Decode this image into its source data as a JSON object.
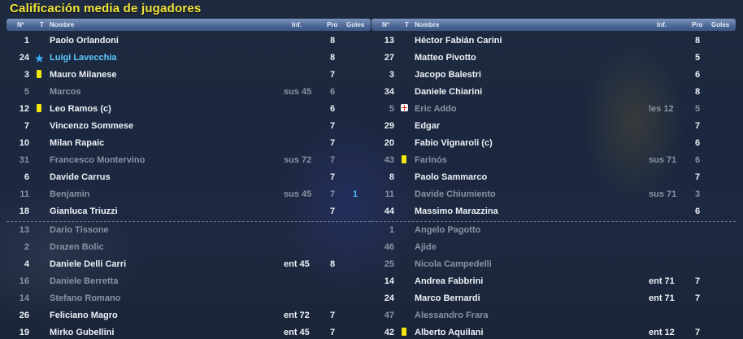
{
  "title": "Calificación media de jugadores",
  "headers": {
    "no": "Nº",
    "t": "T",
    "name": "Nombre",
    "inf": "Inf.",
    "pro": "Pro",
    "goles": "Goles"
  },
  "left": {
    "starters": [
      {
        "no": "1",
        "mark": "",
        "name": "Paolo Orlandoni",
        "inf": "",
        "pro": "8",
        "goles": "",
        "style": "normal"
      },
      {
        "no": "24",
        "mark": "star",
        "name": "Luigi Lavecchia",
        "inf": "",
        "pro": "8",
        "goles": "",
        "style": "highlight"
      },
      {
        "no": "3",
        "mark": "yellow",
        "name": "Mauro Milanese",
        "inf": "",
        "pro": "7",
        "goles": "",
        "style": "normal"
      },
      {
        "no": "5",
        "mark": "",
        "name": "Marcos",
        "inf": "sus 45",
        "pro": "6",
        "goles": "",
        "style": "dim"
      },
      {
        "no": "12",
        "mark": "yellow",
        "name": "Leo Ramos (c)",
        "inf": "",
        "pro": "6",
        "goles": "",
        "style": "normal"
      },
      {
        "no": "7",
        "mark": "",
        "name": "Vincenzo Sommese",
        "inf": "",
        "pro": "7",
        "goles": "",
        "style": "normal"
      },
      {
        "no": "10",
        "mark": "",
        "name": "Milan Rapaic",
        "inf": "",
        "pro": "7",
        "goles": "",
        "style": "normal"
      },
      {
        "no": "31",
        "mark": "",
        "name": "Francesco Montervino",
        "inf": "sus 72",
        "pro": "7",
        "goles": "",
        "style": "dim"
      },
      {
        "no": "6",
        "mark": "",
        "name": "Davide Carrus",
        "inf": "",
        "pro": "7",
        "goles": "",
        "style": "normal"
      },
      {
        "no": "11",
        "mark": "",
        "name": "Benjamin",
        "inf": "sus 45",
        "pro": "7",
        "goles": "1",
        "style": "dim"
      },
      {
        "no": "18",
        "mark": "",
        "name": "Gianluca Triuzzi",
        "inf": "",
        "pro": "7",
        "goles": "",
        "style": "normal"
      }
    ],
    "subs": [
      {
        "no": "13",
        "mark": "",
        "name": "Dario Tissone",
        "inf": "",
        "pro": "",
        "goles": "",
        "style": "dim"
      },
      {
        "no": "2",
        "mark": "",
        "name": "Drazen Bolic",
        "inf": "",
        "pro": "",
        "goles": "",
        "style": "dim"
      },
      {
        "no": "4",
        "mark": "",
        "name": "Daniele Delli Carri",
        "inf": "ent 45",
        "pro": "8",
        "goles": "",
        "style": "normal"
      },
      {
        "no": "16",
        "mark": "",
        "name": "Daniele Berretta",
        "inf": "",
        "pro": "",
        "goles": "",
        "style": "dim"
      },
      {
        "no": "14",
        "mark": "",
        "name": "Stefano Romano",
        "inf": "",
        "pro": "",
        "goles": "",
        "style": "dim"
      },
      {
        "no": "26",
        "mark": "",
        "name": "Feliciano Magro",
        "inf": "ent 72",
        "pro": "7",
        "goles": "",
        "style": "normal"
      },
      {
        "no": "19",
        "mark": "",
        "name": "Mirko Gubellini",
        "inf": "ent 45",
        "pro": "7",
        "goles": "",
        "style": "normal"
      }
    ]
  },
  "right": {
    "starters": [
      {
        "no": "13",
        "mark": "",
        "name": "Héctor Fabián Carini",
        "inf": "",
        "pro": "8",
        "goles": "",
        "style": "normal"
      },
      {
        "no": "27",
        "mark": "",
        "name": "Matteo Pivotto",
        "inf": "",
        "pro": "5",
        "goles": "",
        "style": "normal"
      },
      {
        "no": "3",
        "mark": "",
        "name": "Jacopo Balestri",
        "inf": "",
        "pro": "6",
        "goles": "",
        "style": "normal"
      },
      {
        "no": "34",
        "mark": "",
        "name": "Daniele Chiarini",
        "inf": "",
        "pro": "8",
        "goles": "",
        "style": "normal"
      },
      {
        "no": "5",
        "mark": "injury",
        "name": "Eric Addo",
        "inf": "les 12",
        "pro": "5",
        "goles": "",
        "style": "dim"
      },
      {
        "no": "29",
        "mark": "",
        "name": "Edgar",
        "inf": "",
        "pro": "7",
        "goles": "",
        "style": "normal"
      },
      {
        "no": "20",
        "mark": "",
        "name": "Fabio Vignaroli (c)",
        "inf": "",
        "pro": "6",
        "goles": "",
        "style": "normal"
      },
      {
        "no": "43",
        "mark": "yellow",
        "name": "Farinós",
        "inf": "sus 71",
        "pro": "6",
        "goles": "",
        "style": "dim"
      },
      {
        "no": "8",
        "mark": "",
        "name": "Paolo Sammarco",
        "inf": "",
        "pro": "7",
        "goles": "",
        "style": "normal"
      },
      {
        "no": "11",
        "mark": "",
        "name": "Davide Chiumiento",
        "inf": "sus 71",
        "pro": "3",
        "goles": "",
        "style": "dim"
      },
      {
        "no": "44",
        "mark": "",
        "name": "Massimo Marazzina",
        "inf": "",
        "pro": "6",
        "goles": "",
        "style": "normal"
      }
    ],
    "subs": [
      {
        "no": "1",
        "mark": "",
        "name": "Angelo Pagotto",
        "inf": "",
        "pro": "",
        "goles": "",
        "style": "dim"
      },
      {
        "no": "46",
        "mark": "",
        "name": "Ajide",
        "inf": "",
        "pro": "",
        "goles": "",
        "style": "dim"
      },
      {
        "no": "25",
        "mark": "",
        "name": "Nicola Campedelli",
        "inf": "",
        "pro": "",
        "goles": "",
        "style": "dim"
      },
      {
        "no": "14",
        "mark": "",
        "name": "Andrea Fabbrini",
        "inf": "ent 71",
        "pro": "7",
        "goles": "",
        "style": "normal"
      },
      {
        "no": "24",
        "mark": "",
        "name": "Marco Bernardi",
        "inf": "ent 71",
        "pro": "7",
        "goles": "",
        "style": "normal"
      },
      {
        "no": "47",
        "mark": "",
        "name": "Alessandro Frara",
        "inf": "",
        "pro": "",
        "goles": "",
        "style": "dim"
      },
      {
        "no": "42",
        "mark": "yellow",
        "name": "Alberto Aquilani",
        "inf": "ent 12",
        "pro": "7",
        "goles": "",
        "style": "normal"
      }
    ]
  },
  "colors": {
    "title": "#f2e63a",
    "highlight": "#5ec8ff",
    "yellow_card": "#f2e60e",
    "dim_text": "#8a93a3"
  },
  "icons": {
    "star": "favourite-star-icon",
    "yellow": "yellow-card-icon",
    "injury": "injury-cross-icon"
  }
}
